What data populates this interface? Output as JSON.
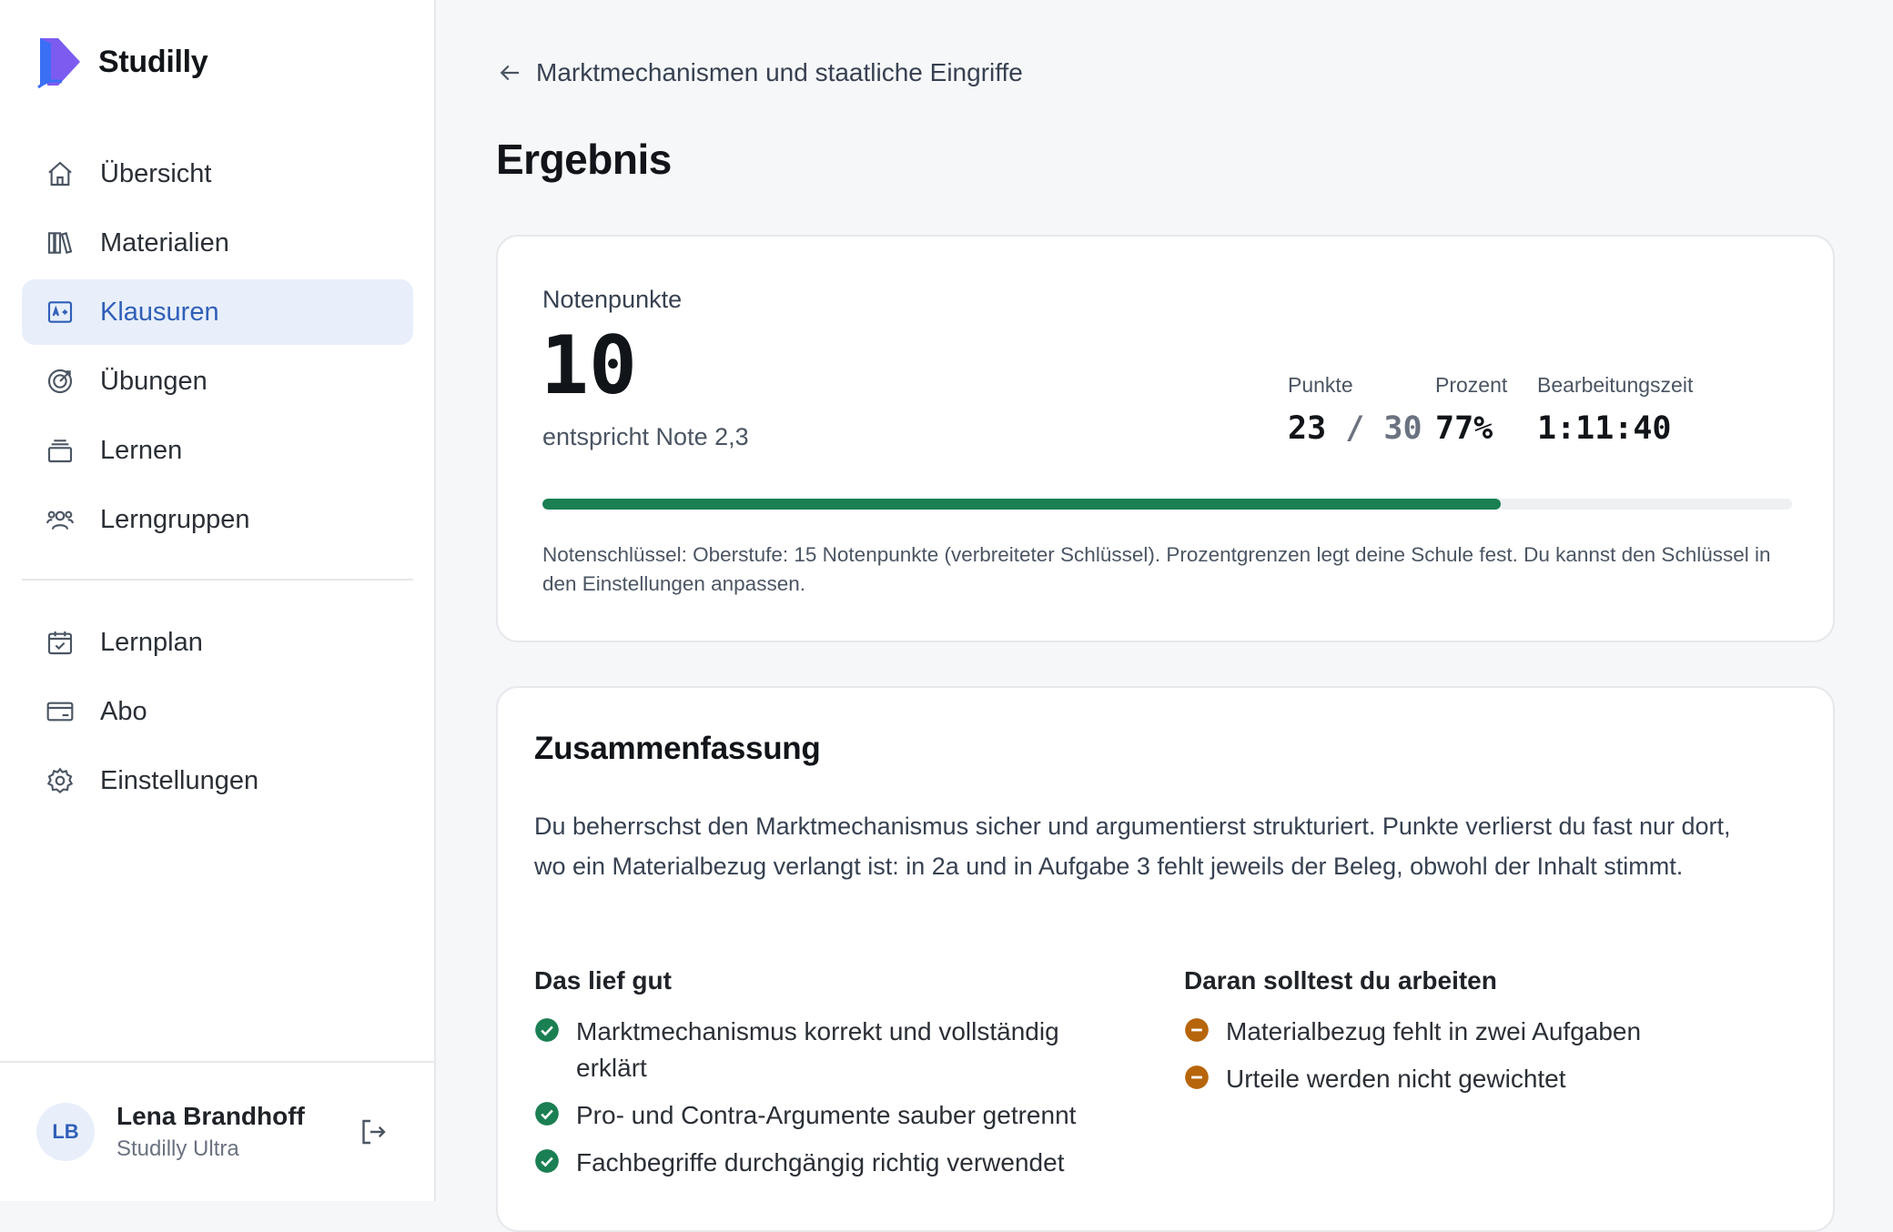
{
  "brand": {
    "name": "Studilly"
  },
  "nav": {
    "primary": [
      {
        "label": "Übersicht",
        "icon": "home-icon"
      },
      {
        "label": "Materialien",
        "icon": "books-icon"
      },
      {
        "label": "Klausuren",
        "icon": "exam-icon",
        "active": true
      },
      {
        "label": "Übungen",
        "icon": "target-icon"
      },
      {
        "label": "Lernen",
        "icon": "stack-icon"
      },
      {
        "label": "Lerngruppen",
        "icon": "group-icon"
      }
    ],
    "secondary": [
      {
        "label": "Lernplan",
        "icon": "calendar-icon"
      },
      {
        "label": "Abo",
        "icon": "card-icon"
      },
      {
        "label": "Einstellungen",
        "icon": "gear-icon"
      }
    ]
  },
  "user": {
    "initials": "LB",
    "name": "Lena Brandhoff",
    "plan": "Studilly Ultra"
  },
  "breadcrumb": {
    "label": "Marktmechanismen und staatliche Eingriffe"
  },
  "page": {
    "title": "Ergebnis"
  },
  "result": {
    "label": "Notenpunkte",
    "grade": "10",
    "note": "entspricht Note 2,3",
    "stats": {
      "points_label": "Punkte",
      "points_value": "23",
      "points_sep": " / ",
      "points_max": "30",
      "percent_label": "Prozent",
      "percent_value": "77%",
      "time_label": "Bearbeitungszeit",
      "time_value": "1:11:40"
    },
    "progress": 0.767,
    "key_text": "Notenschlüssel: Oberstufe: 15 Notenpunkte (verbreiteter Schlüssel). Prozentgrenzen legt deine Schule fest. Du kannst den Schlüssel in den Einstellungen anpassen."
  },
  "summary": {
    "title": "Zusammenfassung",
    "text": "Du beherrschst den Marktmechanismus sicher und argumentierst strukturiert. Punkte verlierst du fast nur dort, wo ein Materialbezug verlangt ist: in 2a und in Aufgabe 3 fehlt jeweils der Beleg, obwohl der Inhalt stimmt.",
    "good": {
      "title": "Das lief gut",
      "items": [
        "Marktmechanismus korrekt und vollständig erklärt",
        "Pro- und Contra-Argumente sauber getrennt",
        "Fachbegriffe durchgängig richtig verwendet"
      ]
    },
    "work": {
      "title": "Daran solltest du arbeiten",
      "items": [
        "Materialbezug fehlt in zwei Aufgaben",
        "Urteile werden nicht gewichtet"
      ]
    }
  },
  "colors": {
    "accent": "#2f5fb8",
    "active_bg": "#e8effb",
    "success": "#1a7f52",
    "warning": "#b7650b"
  }
}
